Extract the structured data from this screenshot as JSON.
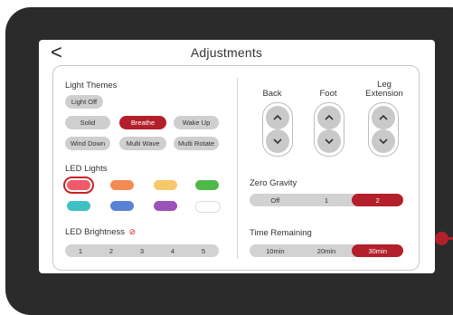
{
  "header": {
    "title": "Adjustments",
    "back_label": "<"
  },
  "light_themes": {
    "label": "Light Themes",
    "items": [
      "Light Off",
      "Solid",
      "Breathe",
      "Wake Up",
      "Wind Down",
      "Multi Wave",
      "Multi Rotate"
    ],
    "active": "Breathe"
  },
  "led_lights": {
    "label": "LED Lights",
    "colors": [
      "#f05a6a",
      "#f48b55",
      "#f7c86a",
      "#4fb84a",
      "#3ec1c4",
      "#5a82d4",
      "#9b52b8",
      "#ffffff"
    ],
    "selected_index": 0
  },
  "led_brightness": {
    "label": "LED Brightness",
    "levels": [
      "1",
      "2",
      "3",
      "4",
      "5"
    ]
  },
  "position_controls": {
    "columns": [
      {
        "label": "Back"
      },
      {
        "label": "Foot"
      },
      {
        "label": "Leg Extension"
      }
    ]
  },
  "zero_gravity": {
    "label": "Zero Gravity",
    "options": [
      "Off",
      "1",
      "2"
    ],
    "active": "2"
  },
  "time_remaining": {
    "label": "Time Remaining",
    "options": [
      "10min",
      "20min",
      "30min"
    ],
    "active": "30min"
  },
  "colors": {
    "accent": "#b3202b",
    "pill": "#cfcfcf",
    "frame": "#2b2b2b"
  }
}
